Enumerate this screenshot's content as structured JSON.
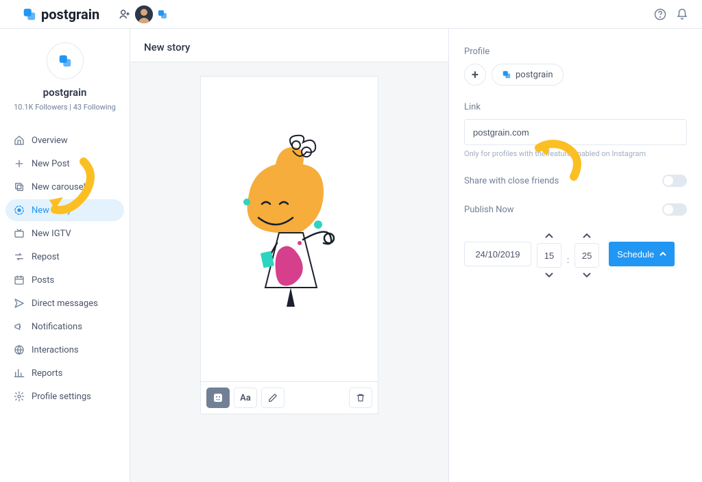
{
  "brand": {
    "name": "postgrain"
  },
  "sidebar": {
    "profile_name": "postgrain",
    "stats": "10.1K Followers | 43 Following",
    "items": [
      {
        "label": "Overview",
        "icon": "home"
      },
      {
        "label": "New Post",
        "icon": "plus"
      },
      {
        "label": "New carousel",
        "icon": "layers"
      },
      {
        "label": "New story",
        "icon": "story",
        "active": true
      },
      {
        "label": "New IGTV",
        "icon": "tv"
      },
      {
        "label": "Repost",
        "icon": "repost"
      },
      {
        "label": "Posts",
        "icon": "calendar"
      },
      {
        "label": "Direct messages",
        "icon": "send"
      },
      {
        "label": "Notifications",
        "icon": "megaphone"
      },
      {
        "label": "Interactions",
        "icon": "globe"
      },
      {
        "label": "Reports",
        "icon": "chart"
      },
      {
        "label": "Profile settings",
        "icon": "gear"
      }
    ]
  },
  "page": {
    "title": "New story"
  },
  "panel": {
    "profile_label": "Profile",
    "profile_chip": "postgrain",
    "link_label": "Link",
    "link_value": "postgrain.com",
    "link_help": "Only for profiles with the feature enabled on Instagram",
    "close_friends_label": "Share with close friends",
    "publish_now_label": "Publish Now",
    "date": "24/10/2019",
    "hours": "15",
    "minutes": "25",
    "schedule_label": "Schedule"
  },
  "tools": {
    "text_label": "Aa"
  }
}
